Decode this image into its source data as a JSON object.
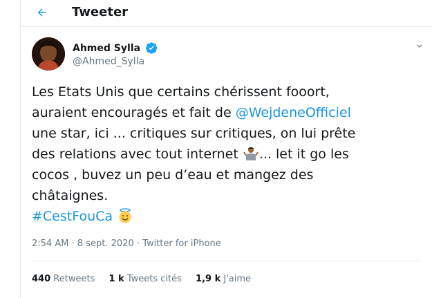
{
  "header": {
    "title": "Tweeter"
  },
  "author": {
    "name": "Ahmed Sylla",
    "handle": "@Ahmed_Sylla"
  },
  "tweet": {
    "line1": "Les Etats Unis que certains chérissent fooort,",
    "line2_a": "auraient encouragés et fait de ",
    "mention": "@WejdeneOfficiel",
    "line3": "une star, ici ... critiques sur critiques, on lui prête",
    "line4_a": "des relations avec tout internet ",
    "line4_b": "... let it go les",
    "line5": "cocos , buvez un peu d’eau et mangez des",
    "line6": "châtaignes.",
    "hashtag": "#CestFouCa",
    "emojis": [
      "man-shrugging-emoji",
      "smiling-face-with-halo-emoji"
    ]
  },
  "meta": {
    "time": "2:54 AM",
    "sep": "·",
    "date": "8 sept. 2020",
    "source": "Twitter for iPhone"
  },
  "stats": {
    "retweets_count": "440",
    "retweets_label": "Retweets",
    "quotes_count": "1 k",
    "quotes_label": "Tweets cités",
    "likes_count": "1,9 k",
    "likes_label": "J'aime"
  },
  "colors": {
    "accent": "#1da1f2",
    "link": "#1b95e0",
    "muted": "#657786",
    "border": "#e6ecf0"
  }
}
